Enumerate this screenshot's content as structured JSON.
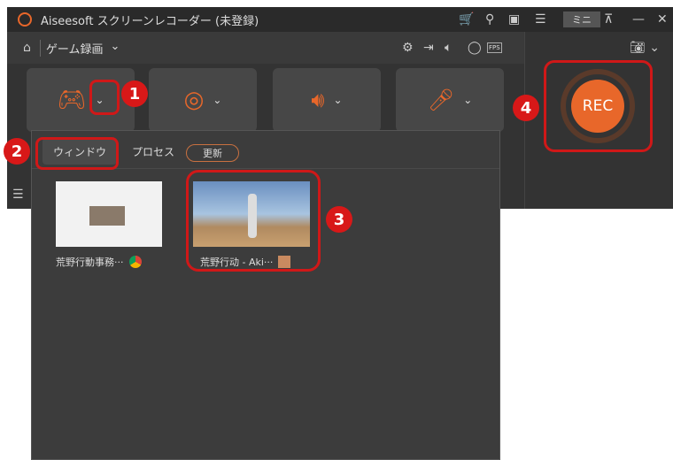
{
  "titlebar": {
    "title": "Aiseesoft スクリーンレコーダー (未登録)",
    "mini_label": "ミニ",
    "icons": [
      "cart-icon",
      "key-icon",
      "feedback-icon",
      "menu-icon",
      "pin-icon",
      "minimize-icon",
      "close-icon"
    ]
  },
  "toolbar": {
    "mode": "ゲーム録画",
    "icons": [
      "settings-icon",
      "export-icon",
      "speaker-icon",
      "mouse-icon",
      "fps-icon"
    ]
  },
  "fps_label": "FPS",
  "rec_label": "REC",
  "accent": "#e8672a",
  "panel": {
    "tabs": [
      "ウィンドウ",
      "プロセス"
    ],
    "refresh": "更新",
    "windows": [
      {
        "title": "荒野行動事務···"
      },
      {
        "title": "荒野行动 - Aki···"
      }
    ]
  },
  "annotations": [
    "1",
    "2",
    "3",
    "4"
  ]
}
